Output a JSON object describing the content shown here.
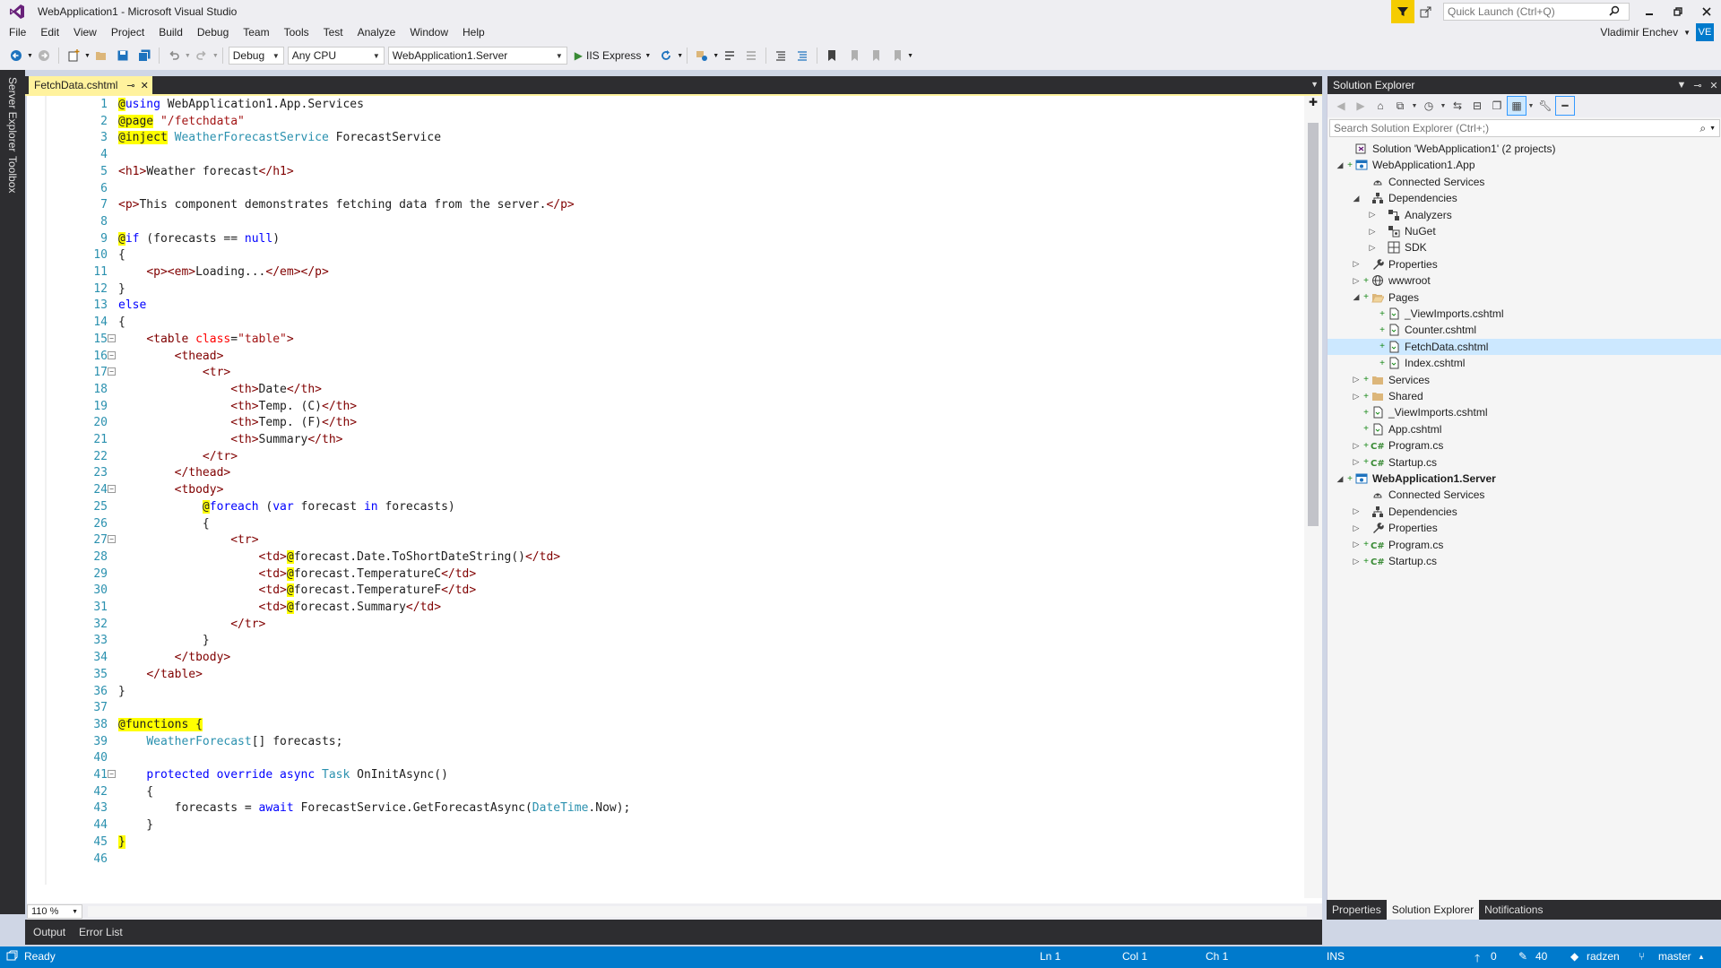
{
  "window": {
    "title": "WebApplication1 - Microsoft Visual Studio"
  },
  "quick_launch": {
    "placeholder": "Quick Launch (Ctrl+Q)"
  },
  "menu": [
    "File",
    "Edit",
    "View",
    "Project",
    "Build",
    "Debug",
    "Team",
    "Tools",
    "Test",
    "Analyze",
    "Window",
    "Help"
  ],
  "user": {
    "name": "Vladimir Enchev",
    "initials": "VE"
  },
  "toolbar": {
    "config": "Debug",
    "platform": "Any CPU",
    "startup_project": "WebApplication1.Server",
    "run_label": "IIS Express"
  },
  "left_tabs": [
    "Server Explorer",
    "Toolbox"
  ],
  "editor": {
    "tab": "FetchData.cshtml",
    "zoom": "110 %",
    "lines": [
      [
        [
          "rz",
          "@"
        ],
        [
          "k",
          "using"
        ],
        [
          "",
          " WebApplication1.App.Services"
        ]
      ],
      [
        [
          "rz",
          "@page"
        ],
        [
          "",
          " "
        ],
        [
          "s",
          "\"/fetchdata\""
        ]
      ],
      [
        [
          "rz",
          "@inject"
        ],
        [
          "",
          " "
        ],
        [
          "t",
          "WeatherForecastService"
        ],
        [
          "",
          " ForecastService"
        ]
      ],
      [],
      [
        [
          "tag",
          "<h1>"
        ],
        [
          "",
          "Weather forecast"
        ],
        [
          "tag",
          "</h1>"
        ]
      ],
      [],
      [
        [
          "tag",
          "<p>"
        ],
        [
          "",
          "This component demonstrates fetching data from the server."
        ],
        [
          "tag",
          "</p>"
        ]
      ],
      [],
      [
        [
          "rz",
          "@"
        ],
        [
          "k",
          "if"
        ],
        [
          "",
          " (forecasts == "
        ],
        [
          "k",
          "null"
        ],
        [
          "",
          ")"
        ]
      ],
      [
        [
          "",
          "{"
        ]
      ],
      [
        [
          "",
          "    "
        ],
        [
          "tag",
          "<p><em>"
        ],
        [
          "",
          "Loading..."
        ],
        [
          "tag",
          "</em></p>"
        ]
      ],
      [
        [
          "",
          "}"
        ]
      ],
      [
        [
          "k",
          "else"
        ]
      ],
      [
        [
          "",
          "{"
        ]
      ],
      [
        [
          "",
          "    "
        ],
        [
          "tag",
          "<table"
        ],
        [
          "",
          " "
        ],
        [
          "attr",
          "class"
        ],
        [
          "",
          "="
        ],
        [
          "s",
          "\"table\""
        ],
        [
          "tag",
          ">"
        ]
      ],
      [
        [
          "",
          "        "
        ],
        [
          "tag",
          "<thead>"
        ]
      ],
      [
        [
          "",
          "            "
        ],
        [
          "tag",
          "<tr>"
        ]
      ],
      [
        [
          "",
          "                "
        ],
        [
          "tag",
          "<th>"
        ],
        [
          "",
          "Date"
        ],
        [
          "tag",
          "</th>"
        ]
      ],
      [
        [
          "",
          "                "
        ],
        [
          "tag",
          "<th>"
        ],
        [
          "",
          "Temp. (C)"
        ],
        [
          "tag",
          "</th>"
        ]
      ],
      [
        [
          "",
          "                "
        ],
        [
          "tag",
          "<th>"
        ],
        [
          "",
          "Temp. (F)"
        ],
        [
          "tag",
          "</th>"
        ]
      ],
      [
        [
          "",
          "                "
        ],
        [
          "tag",
          "<th>"
        ],
        [
          "",
          "Summary"
        ],
        [
          "tag",
          "</th>"
        ]
      ],
      [
        [
          "",
          "            "
        ],
        [
          "tag",
          "</tr>"
        ]
      ],
      [
        [
          "",
          "        "
        ],
        [
          "tag",
          "</thead>"
        ]
      ],
      [
        [
          "",
          "        "
        ],
        [
          "tag",
          "<tbody>"
        ]
      ],
      [
        [
          "",
          "            "
        ],
        [
          "rz",
          "@"
        ],
        [
          "k",
          "foreach"
        ],
        [
          "",
          " ("
        ],
        [
          "k",
          "var"
        ],
        [
          "",
          " forecast "
        ],
        [
          "k",
          "in"
        ],
        [
          "",
          " forecasts)"
        ]
      ],
      [
        [
          "",
          "            {"
        ]
      ],
      [
        [
          "",
          "                "
        ],
        [
          "tag",
          "<tr>"
        ]
      ],
      [
        [
          "",
          "                    "
        ],
        [
          "tag",
          "<td>"
        ],
        [
          "rz",
          "@"
        ],
        [
          "",
          "forecast.Date.ToShortDateString()"
        ],
        [
          "tag",
          "</td>"
        ]
      ],
      [
        [
          "",
          "                    "
        ],
        [
          "tag",
          "<td>"
        ],
        [
          "rz",
          "@"
        ],
        [
          "",
          "forecast.TemperatureC"
        ],
        [
          "tag",
          "</td>"
        ]
      ],
      [
        [
          "",
          "                    "
        ],
        [
          "tag",
          "<td>"
        ],
        [
          "rz",
          "@"
        ],
        [
          "",
          "forecast.TemperatureF"
        ],
        [
          "tag",
          "</td>"
        ]
      ],
      [
        [
          "",
          "                    "
        ],
        [
          "tag",
          "<td>"
        ],
        [
          "rz",
          "@"
        ],
        [
          "",
          "forecast.Summary"
        ],
        [
          "tag",
          "</td>"
        ]
      ],
      [
        [
          "",
          "                "
        ],
        [
          "tag",
          "</tr>"
        ]
      ],
      [
        [
          "",
          "            }"
        ]
      ],
      [
        [
          "",
          "        "
        ],
        [
          "tag",
          "</tbody>"
        ]
      ],
      [
        [
          "",
          "    "
        ],
        [
          "tag",
          "</table>"
        ]
      ],
      [
        [
          "",
          "}"
        ]
      ],
      [],
      [
        [
          "rz",
          "@functions {"
        ]
      ],
      [
        [
          "",
          "    "
        ],
        [
          "t",
          "WeatherForecast"
        ],
        [
          "",
          "[] forecasts;"
        ]
      ],
      [],
      [
        [
          "",
          "    "
        ],
        [
          "k",
          "protected"
        ],
        [
          "",
          " "
        ],
        [
          "k",
          "override"
        ],
        [
          "",
          " "
        ],
        [
          "k",
          "async"
        ],
        [
          "",
          " "
        ],
        [
          "t",
          "Task"
        ],
        [
          "",
          " OnInitAsync()"
        ]
      ],
      [
        [
          "",
          "    {"
        ]
      ],
      [
        [
          "",
          "        forecasts = "
        ],
        [
          "k",
          "await"
        ],
        [
          "",
          " ForecastService.GetForecastAsync("
        ],
        [
          "t",
          "DateTime"
        ],
        [
          "",
          ".Now);"
        ]
      ],
      [
        [
          "",
          "    }"
        ]
      ],
      [
        [
          "rz",
          "}"
        ]
      ],
      []
    ],
    "fold_lines": [
      15,
      16,
      17,
      24,
      27,
      41
    ]
  },
  "bottom_tabs": [
    "Output",
    "Error List"
  ],
  "solution_explorer": {
    "title": "Solution Explorer",
    "search_placeholder": "Search Solution Explorer (Ctrl+;)",
    "tree": [
      {
        "label": "Solution 'WebApplication1' (2 projects)",
        "depth": 0,
        "exp": "",
        "plus": "",
        "icon": "solution-icon",
        "bold": false
      },
      {
        "label": "WebApplication1.App",
        "depth": 0,
        "exp": "◢",
        "plus": "+",
        "icon": "csproj-icon",
        "bold": false
      },
      {
        "label": "Connected Services",
        "depth": 1,
        "exp": "",
        "plus": "",
        "icon": "connected-services-icon",
        "bold": false
      },
      {
        "label": "Dependencies",
        "depth": 1,
        "exp": "◢",
        "plus": "",
        "icon": "dependencies-icon",
        "bold": false
      },
      {
        "label": "Analyzers",
        "depth": 2,
        "exp": "▷",
        "plus": "",
        "icon": "analyzers-icon",
        "bold": false
      },
      {
        "label": "NuGet",
        "depth": 2,
        "exp": "▷",
        "plus": "",
        "icon": "nuget-icon",
        "bold": false
      },
      {
        "label": "SDK",
        "depth": 2,
        "exp": "▷",
        "plus": "",
        "icon": "sdk-icon",
        "bold": false
      },
      {
        "label": "Properties",
        "depth": 1,
        "exp": "▷",
        "plus": "",
        "icon": "wrench-icon",
        "bold": false
      },
      {
        "label": "wwwroot",
        "depth": 1,
        "exp": "▷",
        "plus": "+",
        "icon": "globe-icon",
        "bold": false
      },
      {
        "label": "Pages",
        "depth": 1,
        "exp": "◢",
        "plus": "+",
        "icon": "folder-open-icon",
        "bold": false
      },
      {
        "label": "_ViewImports.cshtml",
        "depth": 2,
        "exp": "",
        "plus": "+",
        "icon": "file-icon",
        "bold": false
      },
      {
        "label": "Counter.cshtml",
        "depth": 2,
        "exp": "",
        "plus": "+",
        "icon": "file-icon",
        "bold": false
      },
      {
        "label": "FetchData.cshtml",
        "depth": 2,
        "exp": "",
        "plus": "+",
        "icon": "file-icon",
        "bold": false,
        "selected": true
      },
      {
        "label": "Index.cshtml",
        "depth": 2,
        "exp": "",
        "plus": "+",
        "icon": "file-icon",
        "bold": false
      },
      {
        "label": "Services",
        "depth": 1,
        "exp": "▷",
        "plus": "+",
        "icon": "folder-icon",
        "bold": false
      },
      {
        "label": "Shared",
        "depth": 1,
        "exp": "▷",
        "plus": "+",
        "icon": "folder-icon",
        "bold": false
      },
      {
        "label": "_ViewImports.cshtml",
        "depth": 1,
        "exp": "",
        "plus": "+",
        "icon": "file-icon",
        "bold": false
      },
      {
        "label": "App.cshtml",
        "depth": 1,
        "exp": "",
        "plus": "+",
        "icon": "file-icon",
        "bold": false
      },
      {
        "label": "Program.cs",
        "depth": 1,
        "exp": "▷",
        "plus": "+",
        "icon": "csharp-icon",
        "bold": false
      },
      {
        "label": "Startup.cs",
        "depth": 1,
        "exp": "▷",
        "plus": "+",
        "icon": "csharp-icon",
        "bold": false
      },
      {
        "label": "WebApplication1.Server",
        "depth": 0,
        "exp": "◢",
        "plus": "+",
        "icon": "csproj-icon",
        "bold": true
      },
      {
        "label": "Connected Services",
        "depth": 1,
        "exp": "",
        "plus": "",
        "icon": "connected-services-icon",
        "bold": false
      },
      {
        "label": "Dependencies",
        "depth": 1,
        "exp": "▷",
        "plus": "",
        "icon": "dependencies-icon",
        "bold": false
      },
      {
        "label": "Properties",
        "depth": 1,
        "exp": "▷",
        "plus": "",
        "icon": "wrench-icon",
        "bold": false
      },
      {
        "label": "Program.cs",
        "depth": 1,
        "exp": "▷",
        "plus": "+",
        "icon": "csharp-icon",
        "bold": false
      },
      {
        "label": "Startup.cs",
        "depth": 1,
        "exp": "▷",
        "plus": "+",
        "icon": "csharp-icon",
        "bold": false
      }
    ],
    "bottom_tabs": [
      "Properties",
      "Solution Explorer",
      "Notifications"
    ],
    "active_bottom_tab": "Solution Explorer"
  },
  "status": {
    "ready": "Ready",
    "ln": "Ln 1",
    "col": "Col 1",
    "ch": "Ch 1",
    "ins": "INS",
    "up_count": "0",
    "edit_count": "40",
    "repo": "radzen",
    "branch": "master"
  },
  "colors": {
    "accent": "#007acc",
    "tab_active": "#fff29d",
    "razor_highlight": "#ffff00",
    "dark_chrome": "#2d2d30"
  }
}
